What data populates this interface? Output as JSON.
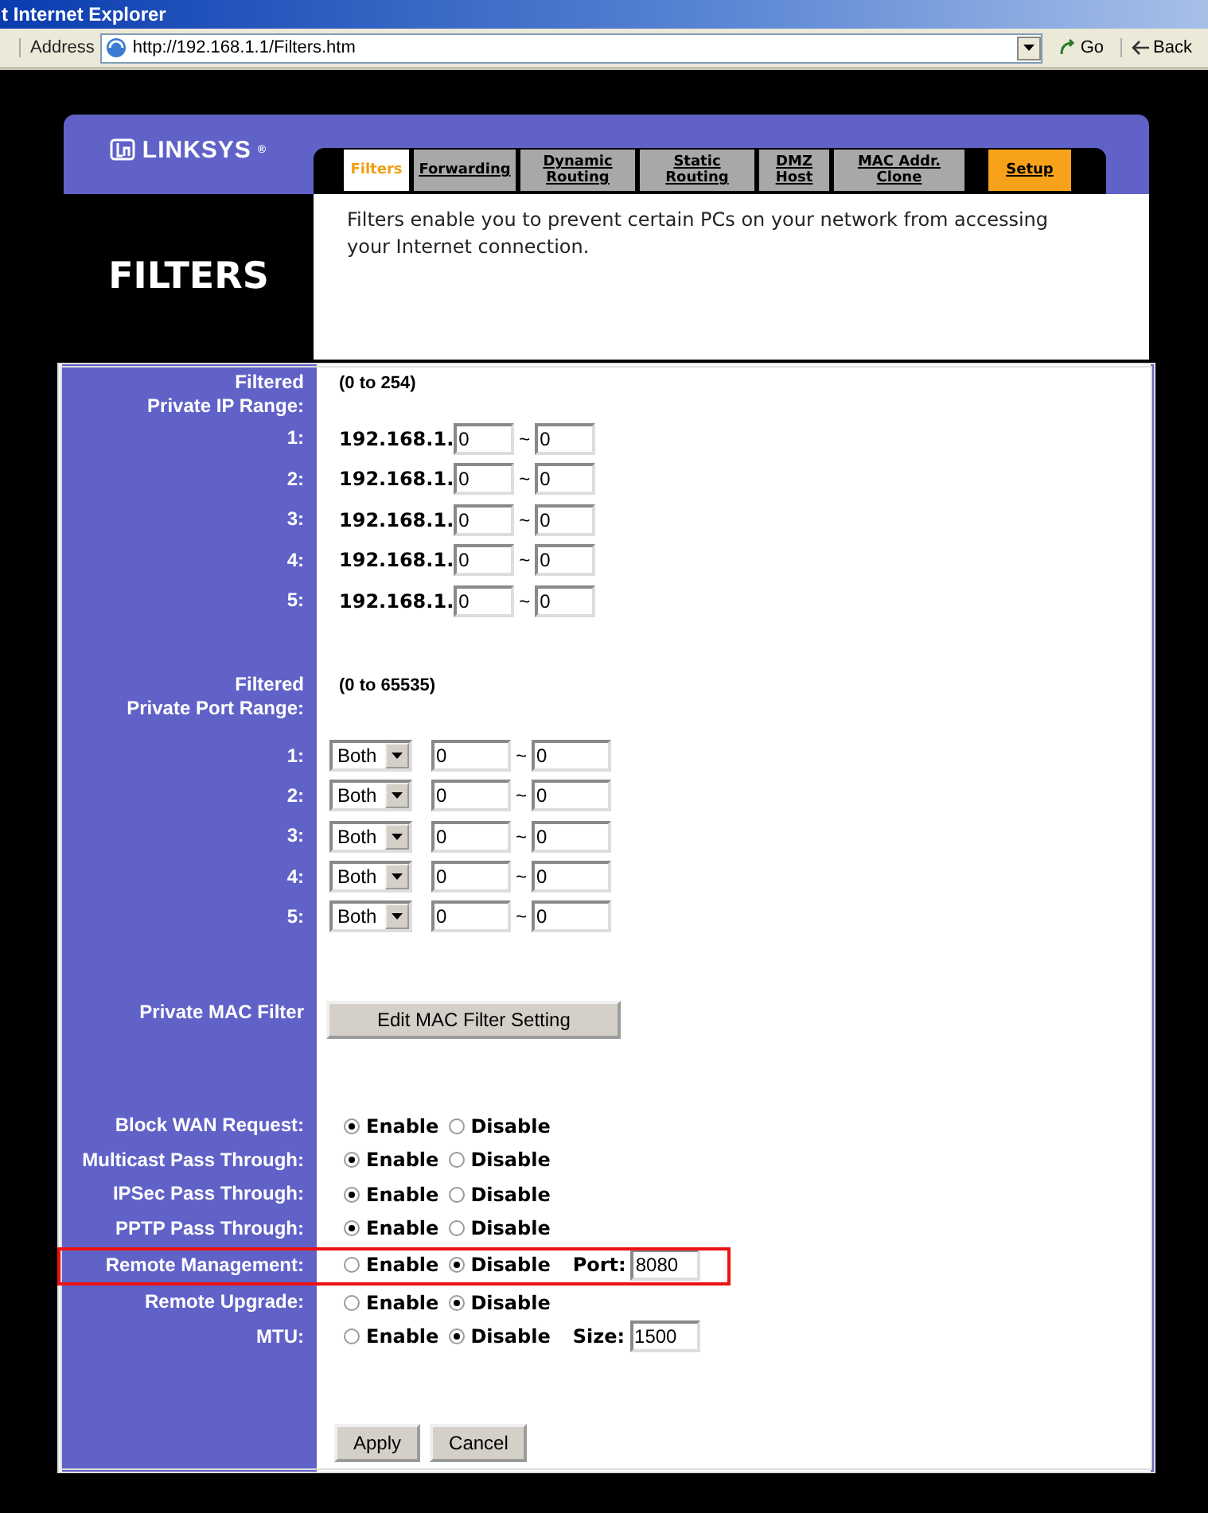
{
  "browser": {
    "title": "t Internet Explorer",
    "address_label": "Address",
    "url": "http://192.168.1.1/Filters.htm",
    "go": "Go",
    "back": "Back"
  },
  "logo": {
    "text": "LINKSYS",
    "mark": "®"
  },
  "tabs": [
    {
      "label": "Filters",
      "selected": true,
      "kind": "tab"
    },
    {
      "label": "Forwarding",
      "selected": false,
      "kind": "tab"
    },
    {
      "label": "Dynamic Routing",
      "selected": false,
      "kind": "tab"
    },
    {
      "label": "Static Routing",
      "selected": false,
      "kind": "tab"
    },
    {
      "label": "DMZ Host",
      "selected": false,
      "kind": "tab"
    },
    {
      "label": "MAC Addr. Clone",
      "selected": false,
      "kind": "tab"
    },
    {
      "label": "Setup",
      "selected": false,
      "kind": "section"
    }
  ],
  "page_title": "FILTERS",
  "description": "Filters enable you to prevent certain PCs on your network from accessing your Internet connection.",
  "ip_range": {
    "label_top": "Filtered",
    "label": "Private IP Range:",
    "hint": "(0 to 254)",
    "rows": [
      {
        "index": "1:",
        "prefix": "192.168.1.",
        "start": "0",
        "separator": "~",
        "end": "0"
      },
      {
        "index": "2:",
        "prefix": "192.168.1.",
        "start": "0",
        "separator": "~",
        "end": "0"
      },
      {
        "index": "3:",
        "prefix": "192.168.1.",
        "start": "0",
        "separator": "~",
        "end": "0"
      },
      {
        "index": "4:",
        "prefix": "192.168.1.",
        "start": "0",
        "separator": "~",
        "end": "0"
      },
      {
        "index": "5:",
        "prefix": "192.168.1.",
        "start": "0",
        "separator": "~",
        "end": "0"
      }
    ]
  },
  "port_range": {
    "label_top": "Filtered",
    "label": "Private Port Range:",
    "hint": "(0 to 65535)",
    "rows": [
      {
        "index": "1:",
        "protocol": "Both",
        "start": "0",
        "separator": "~",
        "end": "0"
      },
      {
        "index": "2:",
        "protocol": "Both",
        "start": "0",
        "separator": "~",
        "end": "0"
      },
      {
        "index": "3:",
        "protocol": "Both",
        "start": "0",
        "separator": "~",
        "end": "0"
      },
      {
        "index": "4:",
        "protocol": "Both",
        "start": "0",
        "separator": "~",
        "end": "0"
      },
      {
        "index": "5:",
        "protocol": "Both",
        "start": "0",
        "separator": "~",
        "end": "0"
      }
    ]
  },
  "mac_filter": {
    "label": "Private MAC Filter",
    "button": "Edit MAC Filter Setting"
  },
  "options": [
    {
      "label": "Block WAN Request:",
      "highlighted": false,
      "choices": [
        {
          "label": "Enable",
          "selected": true
        },
        {
          "label": "Disable",
          "selected": false
        }
      ]
    },
    {
      "label": "Multicast Pass Through:",
      "highlighted": false,
      "choices": [
        {
          "label": "Enable",
          "selected": true
        },
        {
          "label": "Disable",
          "selected": false
        }
      ]
    },
    {
      "label": "IPSec Pass Through:",
      "highlighted": false,
      "choices": [
        {
          "label": "Enable",
          "selected": true
        },
        {
          "label": "Disable",
          "selected": false
        }
      ]
    },
    {
      "label": "PPTP Pass Through:",
      "highlighted": false,
      "choices": [
        {
          "label": "Enable",
          "selected": true
        },
        {
          "label": "Disable",
          "selected": false
        }
      ]
    },
    {
      "label": "Remote Management:",
      "highlighted": true,
      "choices": [
        {
          "label": "Enable",
          "selected": false
        },
        {
          "label": "Disable",
          "selected": true
        }
      ],
      "field": {
        "label": "Port:",
        "value": "8080"
      }
    },
    {
      "label": "Remote Upgrade:",
      "highlighted": false,
      "choices": [
        {
          "label": "Enable",
          "selected": false
        },
        {
          "label": "Disable",
          "selected": true
        }
      ]
    },
    {
      "label": "MTU:",
      "highlighted": false,
      "choices": [
        {
          "label": "Enable",
          "selected": false
        },
        {
          "label": "Disable",
          "selected": true
        }
      ],
      "field": {
        "label": "Size:",
        "value": "1500"
      }
    }
  ],
  "buttons": [
    "Apply",
    "Cancel"
  ]
}
